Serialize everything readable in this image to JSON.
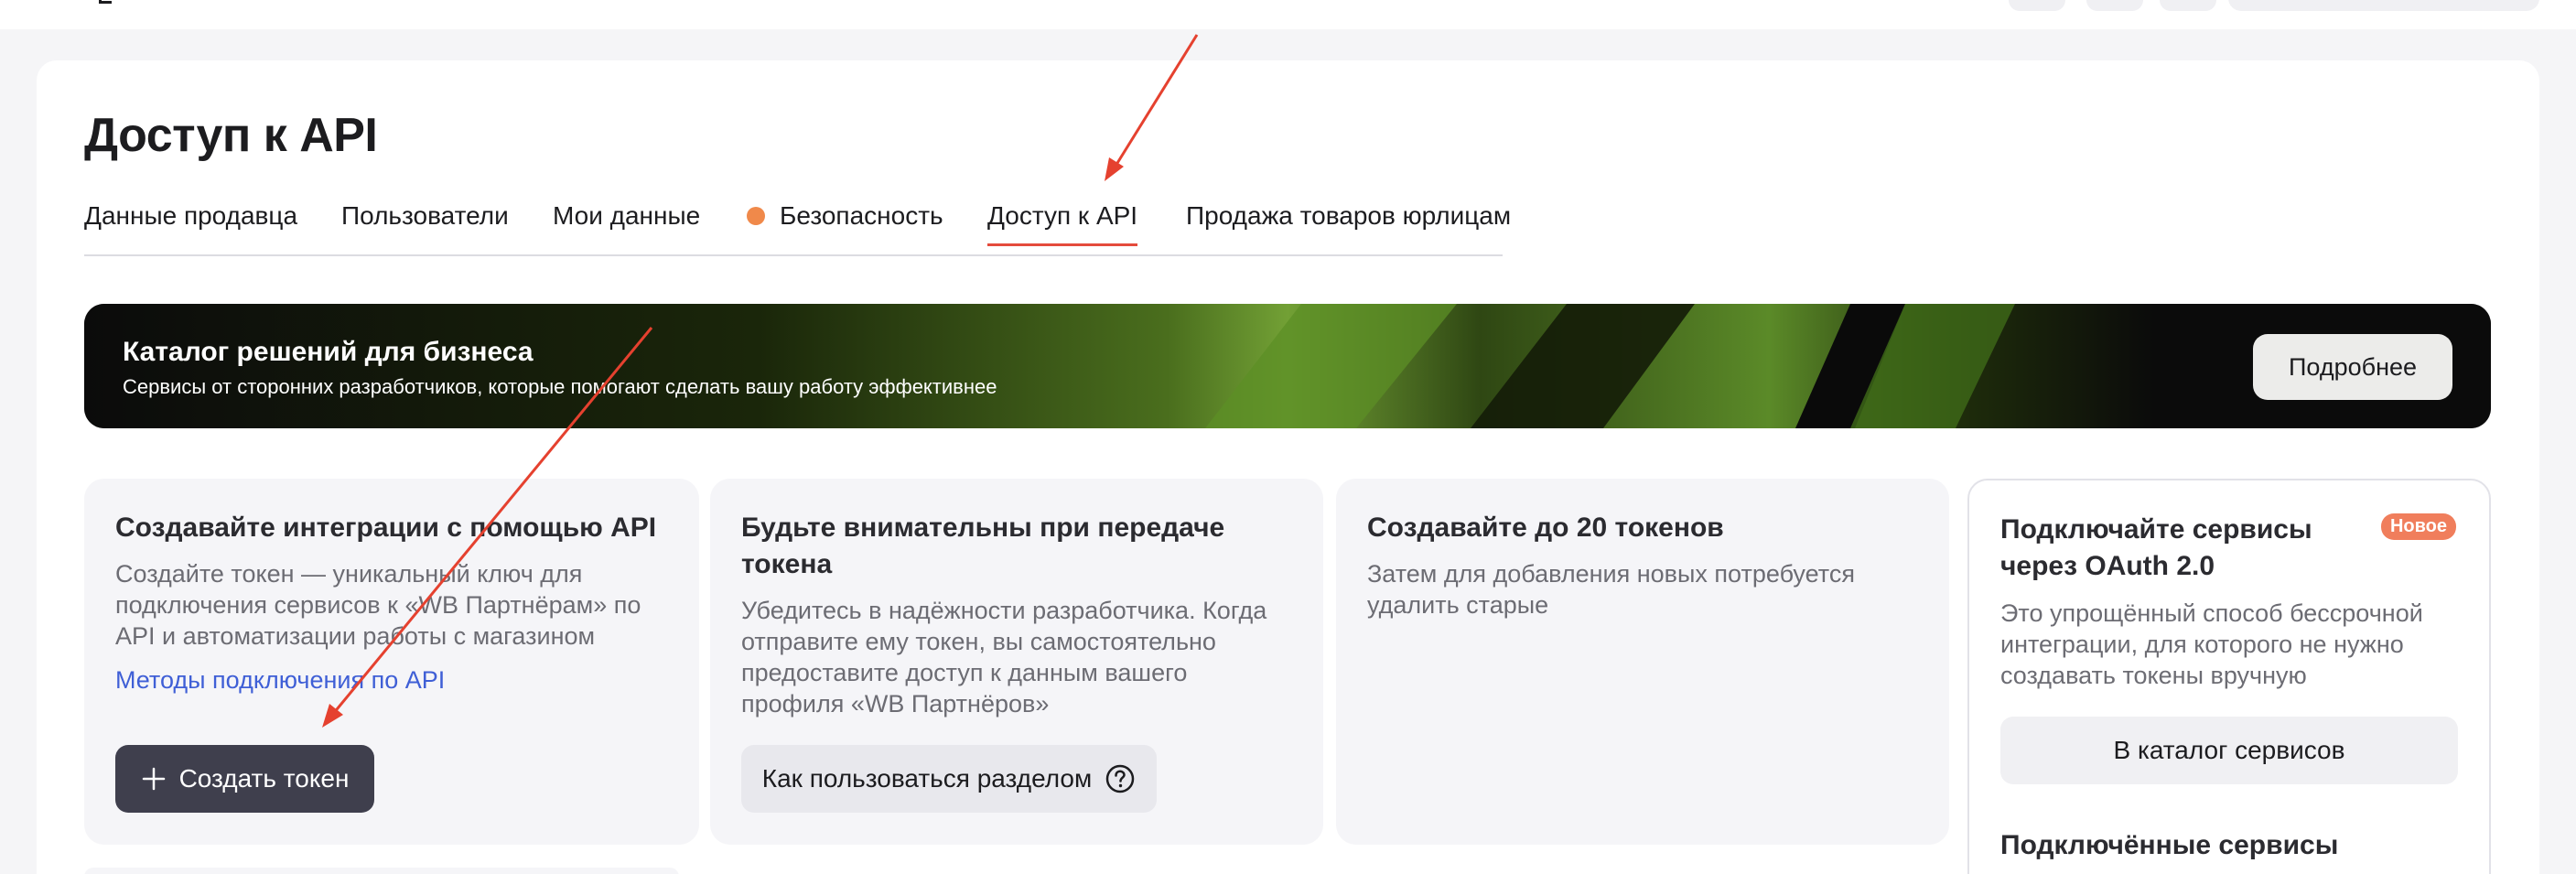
{
  "page": {
    "title": "Доступ к API"
  },
  "tabs": [
    {
      "label": "Данные продавца",
      "active": false
    },
    {
      "label": "Пользователи",
      "active": false
    },
    {
      "label": "Мои данные",
      "active": false
    },
    {
      "label": "Безопасность",
      "active": false,
      "dot_color": "#f0894a"
    },
    {
      "label": "Доступ к API",
      "active": true
    },
    {
      "label": "Продажа товаров юрлицам",
      "active": false
    }
  ],
  "banner": {
    "title": "Каталог решений для бизнеса",
    "subtitle": "Сервисы от сторонних разработчиков, которые помогают сделать вашу работу эффективнее",
    "button_label": "Подробнее"
  },
  "cards": {
    "integrations": {
      "title": "Создавайте интеграции с помощью API",
      "text": "Создайте токен — уникальный ключ для подключения сервисов к «WB Партнёрам» по API и автоматизации работы с магазином",
      "link": "Методы подключения по API",
      "button_label": "Создать токен",
      "button_icon": "plus-icon"
    },
    "careful": {
      "title": "Будьте внимательны при передаче токена",
      "text": "Убедитесь в надёжности разработчика. Когда отправите ему токен, вы самостоятельно предоставите доступ к данным вашего профиля «WB Партнёров»",
      "button_label": "Как пользоваться разделом",
      "button_icon": "question-circle-icon"
    },
    "limit": {
      "title": "Создавайте до 20 токенов",
      "text": "Затем для добавления новых потребуется удалить старые"
    },
    "oauth": {
      "badge": "Новое",
      "title": "Подключайте сервисы через OAuth 2.0",
      "text": "Это упрощённый способ бессрочной интеграции, для которого не нужно создавать токены вручную",
      "button_label": "В каталог сервисов",
      "sub_heading": "Подключённые сервисы"
    }
  },
  "colors": {
    "accent_tab": "#e44b3c",
    "link": "#3f5fd6",
    "dark_button": "#3f3f4d",
    "badge": "#f07e5c",
    "annotation_arrow": "#e5412f"
  }
}
